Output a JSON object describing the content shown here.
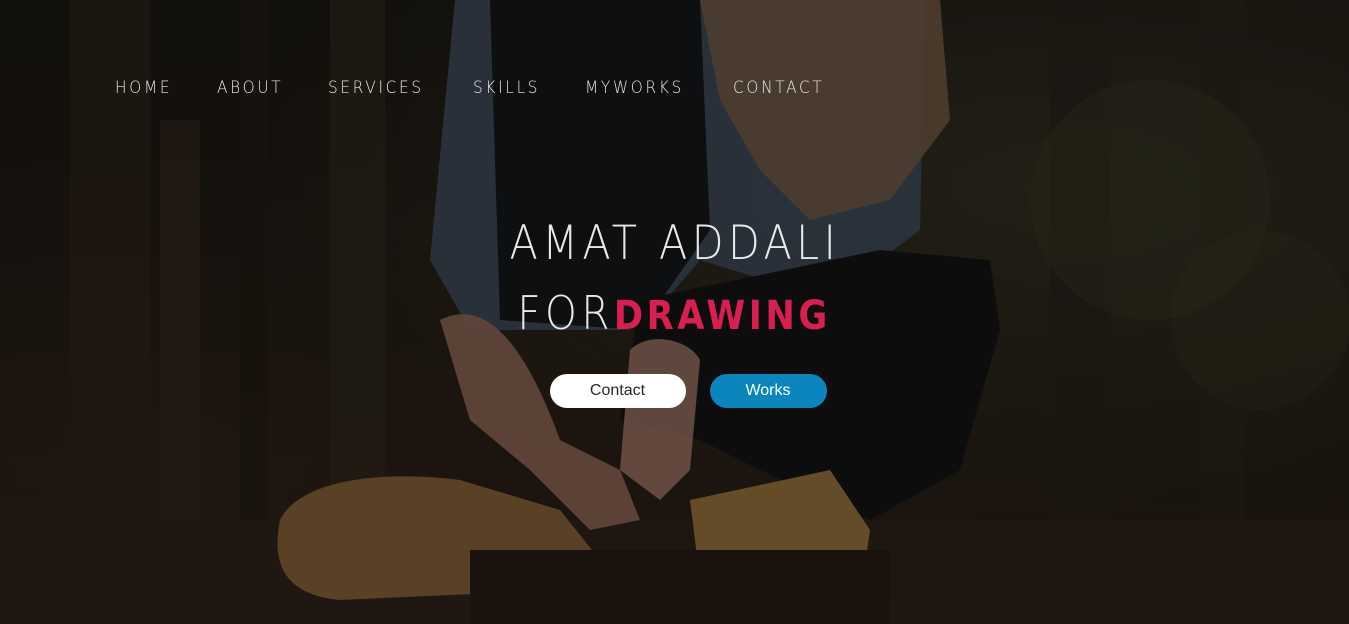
{
  "nav": {
    "items": [
      {
        "label": "HOME"
      },
      {
        "label": "ABOUT"
      },
      {
        "label": "SERVICES"
      },
      {
        "label": "SKILLS"
      },
      {
        "label": "MYWORKS"
      },
      {
        "label": "CONTACT"
      }
    ]
  },
  "hero": {
    "title_line1": "AMAT ADDALI",
    "title_line2_prefix": "FOR",
    "title_line2_accent": "DRAWING",
    "accent_color": "#d81f4f",
    "buttons": {
      "contact": "Contact",
      "works": "Works"
    },
    "works_button_color": "#0a86bd"
  }
}
